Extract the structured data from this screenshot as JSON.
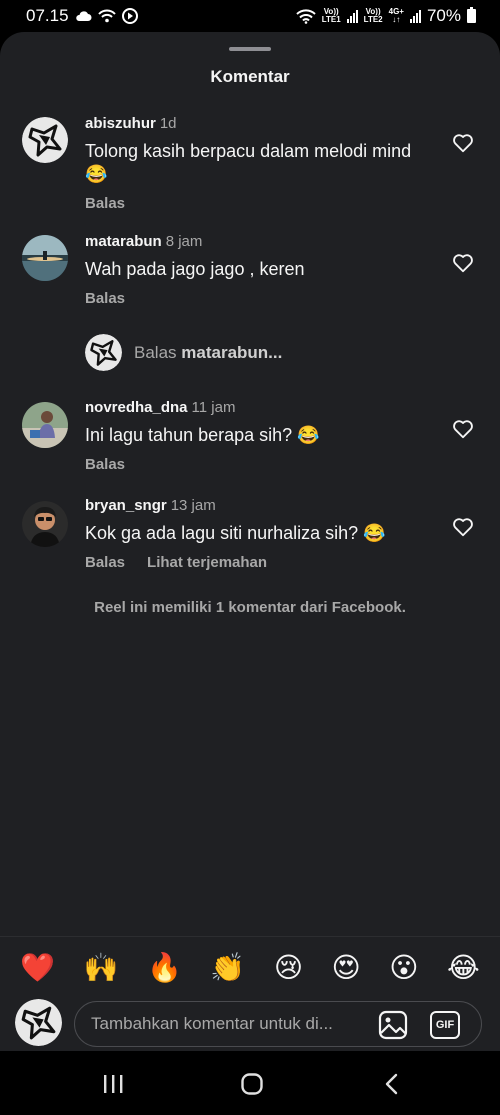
{
  "status_bar": {
    "time": "07.15",
    "sim1_label_top": "Vo))",
    "sim1_label_bottom": "LTE1",
    "sim2_label_top": "Vo))",
    "sim2_label_bottom": "LTE2",
    "network_type": "4G+",
    "battery_text": "70%"
  },
  "sheet": {
    "title": "Komentar"
  },
  "comments": [
    {
      "user": "abiszuhur",
      "time": "1d",
      "text": "Tolong kasih berpacu dalam melodi mind 😂",
      "reply_label": "Balas",
      "translate_label": ""
    },
    {
      "user": "matarabun",
      "time": "8 jam",
      "text": "Wah pada jago jago , keren",
      "reply_label": "Balas",
      "translate_label": ""
    },
    {
      "user": "novredha_dna",
      "time": "11 jam",
      "text": "Ini lagu tahun berapa sih? 😂",
      "reply_label": "Balas",
      "translate_label": ""
    },
    {
      "user": "bryan_sngr",
      "time": "13 jam",
      "text": "Kok ga ada lagu siti nurhaliza sih? 😂",
      "reply_label": "Balas",
      "translate_label": "Lihat terjemahan"
    }
  ],
  "reply_prompt": {
    "prefix": "Balas",
    "user": "matarabun..."
  },
  "facebook_note": "Reel ini memiliki 1 komentar dari Facebook.",
  "emoji_bar": [
    "❤️",
    "🙌",
    "🔥",
    "👏",
    "😢",
    "😍",
    "😮",
    "😂"
  ],
  "comment_input": {
    "placeholder": "Tambahkan komentar untuk di...",
    "gif_label": "GIF"
  },
  "icons": {
    "heart": "heart-outline-icon",
    "image": "image-icon",
    "nav_recents": "recents-icon",
    "nav_home": "home-icon",
    "nav_back": "back-icon"
  },
  "colors": {
    "sheet_bg": "#1f2023",
    "text_primary": "#f5f5f5",
    "text_secondary": "#a8a8a8"
  }
}
